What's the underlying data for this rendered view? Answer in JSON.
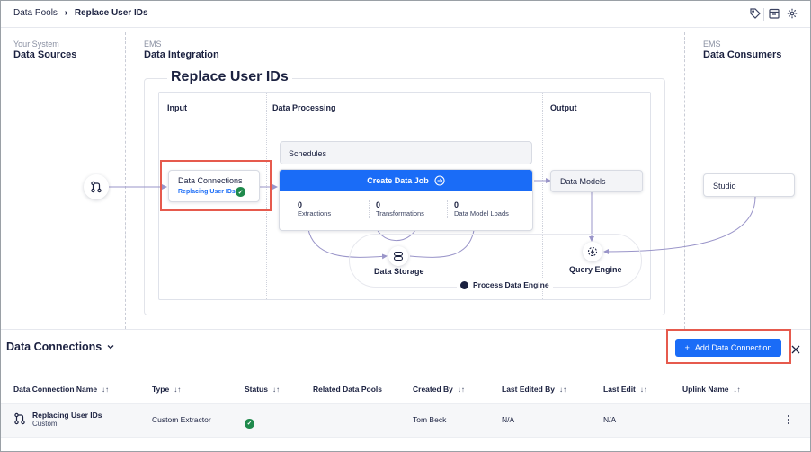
{
  "breadcrumb": {
    "parent": "Data Pools",
    "separator": "›",
    "current": "Replace User IDs"
  },
  "columns": {
    "sources": {
      "sub": "Your System",
      "title": "Data Sources"
    },
    "integration": {
      "sub": "EMS",
      "title": "Data Integration"
    },
    "consumers": {
      "sub": "EMS",
      "title": "Data Consumers"
    }
  },
  "process": {
    "title": "Replace User IDs",
    "sections": {
      "input": "Input",
      "processing": "Data Processing",
      "output": "Output"
    },
    "data_connections": {
      "label": "Data Connections",
      "status": "Replacing User IDs"
    },
    "schedules": "Schedules",
    "create_job": "Create Data Job",
    "stats": [
      {
        "n": "0",
        "label": "Extractions"
      },
      {
        "n": "0",
        "label": "Transformations"
      },
      {
        "n": "0",
        "label": "Data Model Loads"
      }
    ],
    "data_models": "Data Models",
    "data_storage": "Data Storage",
    "query_engine": "Query Engine",
    "process_engine": "Process Data Engine",
    "studio": "Studio"
  },
  "panel": {
    "title": "Data Connections",
    "add_button": "Add Data Connection",
    "add_plus": "+",
    "headers": [
      "Data Connection Name",
      "Type",
      "Status",
      "Related Data Pools",
      "Created By",
      "Last Edited By",
      "Last Edit",
      "Uplink Name"
    ],
    "sortable": [
      true,
      true,
      true,
      false,
      true,
      true,
      true,
      true
    ],
    "rows": [
      {
        "name": "Replacing User IDs",
        "sub": "Custom",
        "type": "Custom Extractor",
        "status": "success",
        "created_by": "Tom Beck",
        "last_edited_by": "N/A",
        "last_edit": "N/A"
      }
    ]
  },
  "colors": {
    "accent": "#1a6cf7",
    "highlight": "#e65a4d",
    "success": "#1f8a4c",
    "text": "#1b2140"
  },
  "icons": [
    "tag-icon",
    "calendar-icon",
    "gear-icon",
    "git-branch-icon",
    "arrow-right-circle-icon",
    "database-icon",
    "query-engine-icon",
    "process-engine-icon",
    "chevron-down-icon",
    "close-icon",
    "more-vertical-icon",
    "sort-icon"
  ]
}
